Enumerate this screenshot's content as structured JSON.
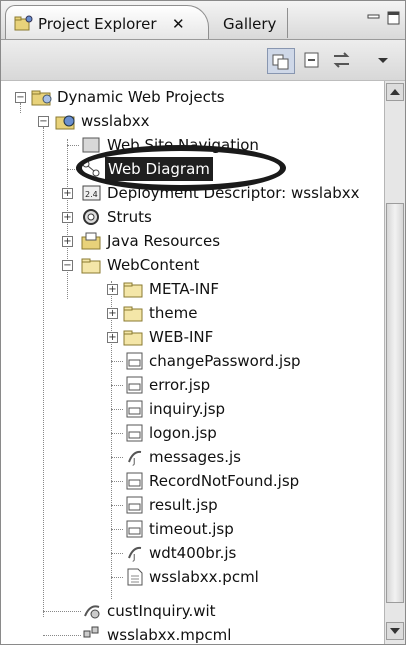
{
  "tabs": {
    "active_label": "Project Explorer",
    "close_glyph": "✕",
    "inactive_label": "Gallery"
  },
  "window_controls": {
    "minimize": "▭",
    "maximize": "❐"
  },
  "toolbar": {
    "icons": [
      "collapse-all-icon",
      "link-editor-icon",
      "filter-icon",
      "view-menu-icon"
    ]
  },
  "tree": {
    "root": {
      "label": "Dynamic Web Projects",
      "icon": "folder-icon"
    },
    "project": {
      "label": "wsslabxx",
      "icon": "web-project-icon"
    },
    "items": [
      {
        "label": "Web Site Navigation",
        "icon": "site-navigation-icon"
      },
      {
        "label": "Web Diagram",
        "icon": "web-diagram-icon",
        "selected": true
      },
      {
        "label": "Deployment Descriptor: wsslabxx",
        "icon": "deployment-descriptor-icon"
      },
      {
        "label": "Struts",
        "icon": "struts-icon"
      },
      {
        "label": "Java Resources",
        "icon": "java-resources-icon"
      },
      {
        "label": "WebContent",
        "icon": "folder-open-icon"
      }
    ],
    "webcontent": [
      {
        "label": "META-INF",
        "icon": "folder-icon",
        "type": "folder"
      },
      {
        "label": "theme",
        "icon": "folder-icon",
        "type": "folder"
      },
      {
        "label": "WEB-INF",
        "icon": "folder-icon",
        "type": "folder"
      },
      {
        "label": "changePassword.jsp",
        "icon": "jsp-file-icon"
      },
      {
        "label": "error.jsp",
        "icon": "jsp-file-icon"
      },
      {
        "label": "inquiry.jsp",
        "icon": "jsp-file-icon"
      },
      {
        "label": "logon.jsp",
        "icon": "jsp-file-icon"
      },
      {
        "label": "messages.js",
        "icon": "js-file-icon"
      },
      {
        "label": "RecordNotFound.jsp",
        "icon": "jsp-file-icon"
      },
      {
        "label": "result.jsp",
        "icon": "jsp-file-icon"
      },
      {
        "label": "timeout.jsp",
        "icon": "jsp-file-icon"
      },
      {
        "label": "wdt400br.js",
        "icon": "js-file-icon"
      },
      {
        "label": "wsslabxx.pcml",
        "icon": "text-file-icon"
      }
    ],
    "project_tail": [
      {
        "label": "custInquiry.wit",
        "icon": "wit-file-icon"
      },
      {
        "label": "wsslabxx.mpcml",
        "icon": "mpcml-file-icon"
      }
    ]
  },
  "colors": {
    "selection_bg": "#1f1f1f",
    "folder_yellow": "#e8d27a",
    "ring": "#1a1a1a"
  }
}
